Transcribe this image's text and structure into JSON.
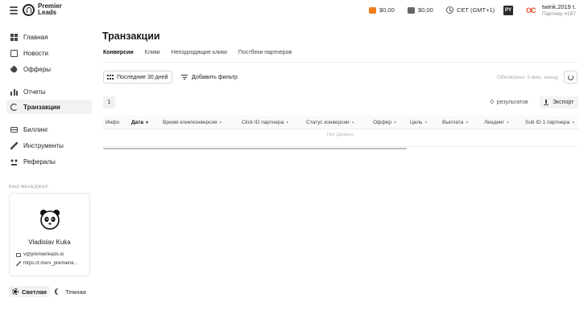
{
  "topbar": {
    "brand": [
      "Premier",
      "Leads"
    ],
    "balances": [
      "$0,00",
      "$0,00"
    ],
    "timezone": "CET (GMT+1)",
    "currency_badge": "PY",
    "partner_logo_text": "OC",
    "user_name": "twink.2019 t.",
    "user_role": "Партнер #187"
  },
  "sidebar": {
    "items": [
      {
        "label": "Главная",
        "icon": "grid-icon"
      },
      {
        "label": "Новости",
        "icon": "news-icon"
      },
      {
        "label": "Офферы",
        "icon": "tag-icon"
      },
      {
        "label": "Отчеты",
        "icon": "bar-chart-icon"
      },
      {
        "label": "Транзакции",
        "icon": "transactions-icon",
        "active": true
      },
      {
        "label": "Биллинг",
        "icon": "card-icon"
      },
      {
        "label": "Инструменты",
        "icon": "wrench-icon"
      },
      {
        "label": "Рефералы",
        "icon": "referrals-icon"
      }
    ],
    "manager_heading": "ВАШ МЕНЕДЖЕР",
    "manager": {
      "name": "Vladislav Kuka",
      "email": "v@premierleads.io",
      "telegram": "https://t.me/v_premierle..."
    },
    "theme": {
      "light": "Светлая",
      "dark": "Темная"
    }
  },
  "main": {
    "title": "Транзакции",
    "tabs": [
      "Конверсии",
      "Клики",
      "Неподходящие клики",
      "Постбеки партнеров"
    ],
    "date_range": "Последние 30 дней",
    "add_filter": "Добавить фильтр",
    "updated": "Обновлено: 0 мин. назад",
    "page": "1",
    "results_count": "0",
    "results_label": "результатов",
    "export_label": "Экспорт",
    "columns": [
      "Инфо",
      "Дата",
      "Время клик/конверсия",
      "Click ID партнера",
      "Статус конверсии",
      "Оффер",
      "Цель",
      "Выплата",
      "Лендинг",
      "Sub ID 1 партнера"
    ],
    "no_data": "Нет данных."
  },
  "colors": {
    "accent_orange": "#f07c1f",
    "partner_red": "#e24b24",
    "active_bg": "#f2f2f2"
  }
}
